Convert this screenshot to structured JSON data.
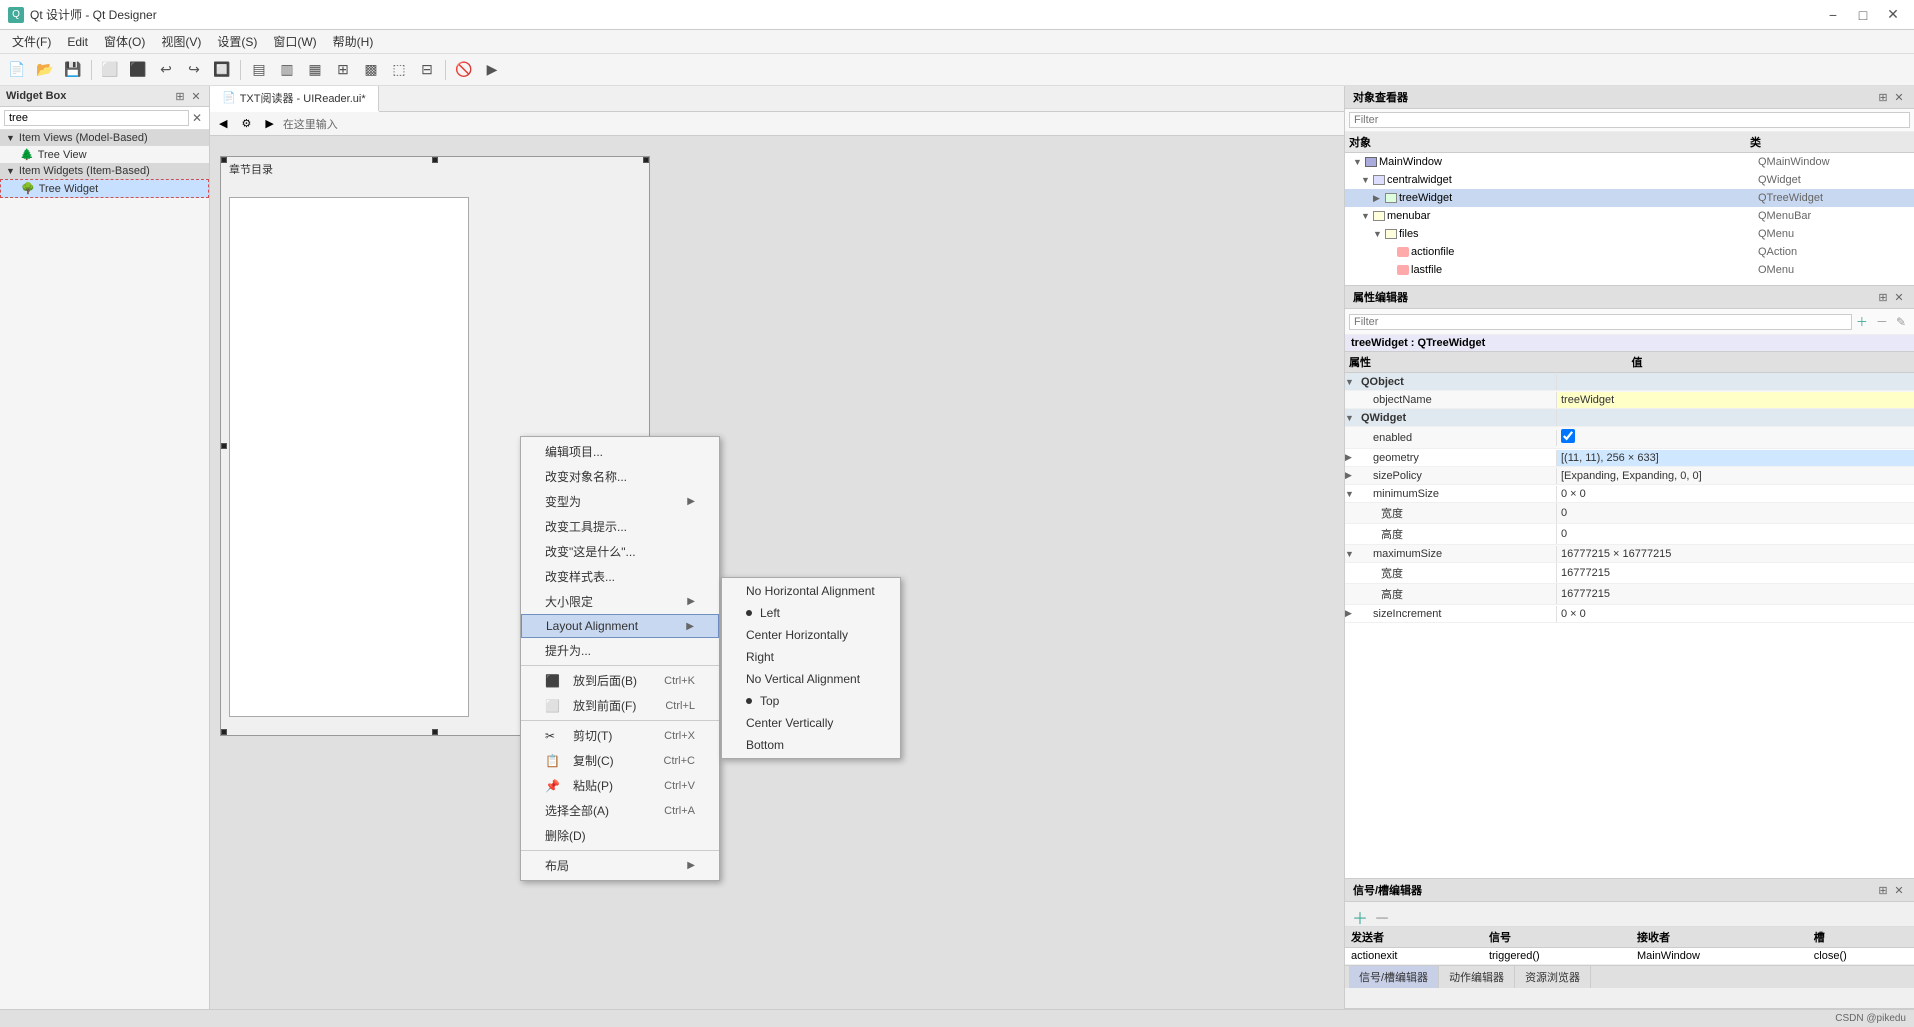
{
  "titleBar": {
    "icon": "Qt",
    "title": "Qt 设计师 - Qt Designer",
    "controls": [
      "minimize",
      "maximize",
      "close"
    ]
  },
  "menuBar": {
    "items": [
      "文件(F)",
      "Edit",
      "窗体(O)",
      "视图(V)",
      "设置(S)",
      "窗口(W)",
      "帮助(H)"
    ]
  },
  "widgetBox": {
    "title": "Widget Box",
    "searchPlaceholder": "tree",
    "categories": [
      {
        "name": "Item Views (Model-Based)",
        "expanded": true,
        "items": [
          "Tree View"
        ]
      },
      {
        "name": "Item Widgets (Item-Based)",
        "expanded": true,
        "items": [
          "Tree Widget"
        ]
      }
    ]
  },
  "designArea": {
    "tabTitle": "TXT阅读器 - UIReader.ui*",
    "formTitle": "章节目录"
  },
  "contextMenu": {
    "items": [
      {
        "label": "编辑项目...",
        "shortcut": ""
      },
      {
        "label": "改变对象名称...",
        "shortcut": ""
      },
      {
        "label": "变型为",
        "shortcut": "",
        "hasSub": true
      },
      {
        "label": "改变工具提示...",
        "shortcut": ""
      },
      {
        "label": "改变\"这是什么\"...",
        "shortcut": ""
      },
      {
        "label": "改变样式表...",
        "shortcut": ""
      },
      {
        "label": "大小限定",
        "shortcut": "",
        "hasSub": true
      },
      {
        "label": "Layout Alignment",
        "shortcut": "",
        "hasSub": true,
        "highlighted": true
      },
      {
        "label": "提升为...",
        "shortcut": ""
      },
      {
        "separator": true
      },
      {
        "label": "放到后面(B)",
        "shortcut": "Ctrl+K",
        "hasIcon": true
      },
      {
        "label": "放到前面(F)",
        "shortcut": "Ctrl+L",
        "hasIcon": true
      },
      {
        "separator": true
      },
      {
        "label": "剪切(T)",
        "shortcut": "Ctrl+X",
        "hasIcon": true
      },
      {
        "label": "复制(C)",
        "shortcut": "Ctrl+C",
        "hasIcon": true
      },
      {
        "label": "粘贴(P)",
        "shortcut": "Ctrl+V",
        "hasIcon": true
      },
      {
        "label": "选择全部(A)",
        "shortcut": "Ctrl+A"
      },
      {
        "label": "删除(D)",
        "shortcut": ""
      },
      {
        "separator": true
      },
      {
        "label": "布局",
        "shortcut": "",
        "hasSub": true
      }
    ]
  },
  "subMenu": {
    "title": "Layout Alignment",
    "items": [
      {
        "label": "No Horizontal Alignment",
        "bullet": false
      },
      {
        "label": "Left",
        "bullet": true
      },
      {
        "label": "Center Horizontally",
        "bullet": false
      },
      {
        "label": "Right",
        "bullet": false
      },
      {
        "label": "No Vertical Alignment",
        "bullet": true
      },
      {
        "label": "Top",
        "bullet": false
      },
      {
        "label": "Center Vertically",
        "bullet": false
      },
      {
        "label": "Bottom",
        "bullet": false
      }
    ]
  },
  "objectInspector": {
    "title": "对象查看器",
    "filterPlaceholder": "Filter",
    "columns": [
      "对象",
      "类"
    ],
    "rows": [
      {
        "name": "MainWindow",
        "class": "QMainWindow",
        "level": 0,
        "expanded": true,
        "type": "window"
      },
      {
        "name": "centralwidget",
        "class": "QWidget",
        "level": 1,
        "expanded": true,
        "type": "widget"
      },
      {
        "name": "treeWidget",
        "class": "QTreeWidget",
        "level": 2,
        "expanded": false,
        "type": "tree",
        "selected": true
      },
      {
        "name": "menubar",
        "class": "QMenuBar",
        "level": 1,
        "expanded": true,
        "type": "menu"
      },
      {
        "name": "files",
        "class": "QMenu",
        "level": 2,
        "expanded": true,
        "type": "menu"
      },
      {
        "name": "actionfile",
        "class": "QAction",
        "level": 3,
        "expanded": false,
        "type": "action"
      },
      {
        "name": "lastfile",
        "class": "OMenu",
        "level": 3,
        "expanded": false,
        "type": "action"
      }
    ]
  },
  "propertyEditor": {
    "title": "属性编辑器",
    "filterPlaceholder": "Filter",
    "widgetLabel": "treeWidget : QTreeWidget",
    "columns": [
      "属性",
      "值"
    ],
    "rows": [
      {
        "name": "QObject",
        "value": "",
        "level": 0,
        "category": true,
        "expanded": true
      },
      {
        "name": "objectName",
        "value": "treeWidget",
        "level": 1,
        "highlight": true
      },
      {
        "name": "QWidget",
        "value": "",
        "level": 0,
        "category": true,
        "expanded": true
      },
      {
        "name": "enabled",
        "value": "☑",
        "level": 1,
        "checkbox": true
      },
      {
        "name": "geometry",
        "value": "[(11, 11), 256 × 633]",
        "level": 1,
        "expandable": true,
        "highlight": true
      },
      {
        "name": "sizePolicy",
        "value": "[Expanding, Expanding, 0, 0]",
        "level": 1,
        "expandable": true
      },
      {
        "name": "minimumSize",
        "value": "0 × 0",
        "level": 1,
        "expandable": true,
        "expanded": true
      },
      {
        "name": "宽度",
        "value": "0",
        "level": 2
      },
      {
        "name": "高度",
        "value": "0",
        "level": 2
      },
      {
        "name": "maximumSize",
        "value": "16777215 × 16777215",
        "level": 1,
        "expandable": true,
        "expanded": true
      },
      {
        "name": "宽度",
        "value": "16777215",
        "level": 2
      },
      {
        "name": "高度",
        "value": "16777215",
        "level": 2
      },
      {
        "name": "sizeIncrement",
        "value": "0 × 0",
        "level": 1,
        "expandable": true
      }
    ]
  },
  "signalEditor": {
    "title": "信号/槽编辑器",
    "columns": [
      "发送者",
      "信号",
      "接收者",
      "槽"
    ],
    "rows": [
      {
        "sender": "actionexit",
        "signal": "triggered()",
        "receiver": "MainWindow",
        "slot": "close()"
      }
    ]
  },
  "bottomTabs": [
    "信号/槽编辑器",
    "动作编辑器",
    "资源浏览器"
  ],
  "statusBar": {
    "text": "CSDN @pikedu"
  }
}
